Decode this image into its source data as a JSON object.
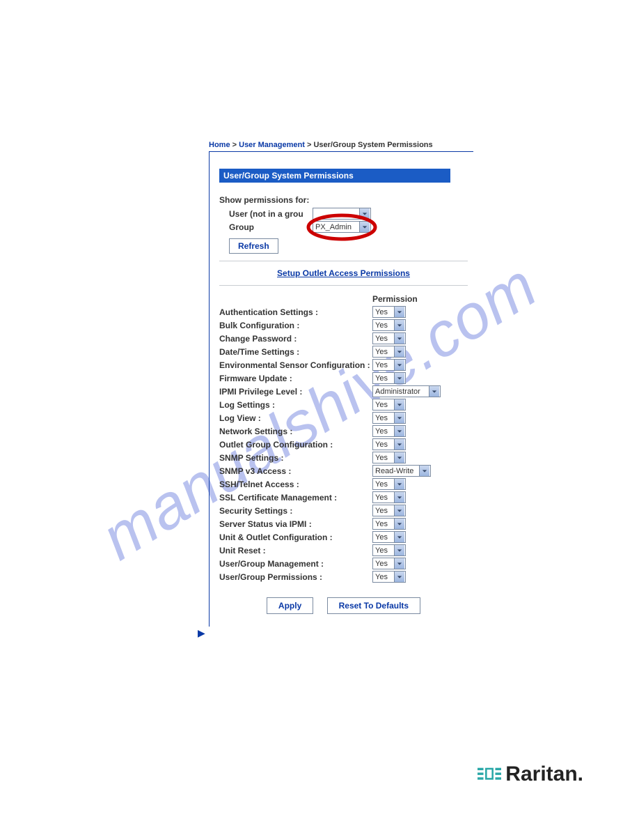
{
  "breadcrumb": {
    "home": "Home",
    "sep": ">",
    "user_mgmt": "User Management",
    "current": "User/Group System Permissions"
  },
  "panel": {
    "title": "User/Group System Permissions"
  },
  "show_perm": {
    "heading": "Show permissions for:",
    "user_label": "User (not in a grou",
    "group_label": "Group",
    "group_value": "PX_Admin",
    "refresh": "Refresh"
  },
  "outlet_link": "Setup Outlet Access Permissions",
  "col_permission": "Permission",
  "permissions": [
    {
      "label": "Authentication Settings :",
      "value": "Yes",
      "type": "yn"
    },
    {
      "label": "Bulk Configuration :",
      "value": "Yes",
      "type": "yn"
    },
    {
      "label": "Change Password :",
      "value": "Yes",
      "type": "yn"
    },
    {
      "label": "Date/Time Settings :",
      "value": "Yes",
      "type": "yn"
    },
    {
      "label": "Environmental Sensor Configuration :",
      "value": "Yes",
      "type": "yn"
    },
    {
      "label": "Firmware Update :",
      "value": "Yes",
      "type": "yn"
    },
    {
      "label": "IPMI Privilege Level :",
      "value": "Administrator",
      "type": "ipmi"
    },
    {
      "label": "Log Settings :",
      "value": "Yes",
      "type": "yn"
    },
    {
      "label": "Log View :",
      "value": "Yes",
      "type": "yn"
    },
    {
      "label": "Network Settings :",
      "value": "Yes",
      "type": "yn"
    },
    {
      "label": "Outlet Group Configuration :",
      "value": "Yes",
      "type": "yn"
    },
    {
      "label": "SNMP Settings :",
      "value": "Yes",
      "type": "yn"
    },
    {
      "label": "SNMP v3 Access :",
      "value": "Read-Write",
      "type": "snmp"
    },
    {
      "label": "SSH/Telnet Access :",
      "value": "Yes",
      "type": "yn"
    },
    {
      "label": "SSL Certificate Management :",
      "value": "Yes",
      "type": "yn"
    },
    {
      "label": "Security Settings :",
      "value": "Yes",
      "type": "yn"
    },
    {
      "label": "Server Status via IPMI :",
      "value": "Yes",
      "type": "yn"
    },
    {
      "label": "Unit & Outlet Configuration :",
      "value": "Yes",
      "type": "yn"
    },
    {
      "label": "Unit Reset :",
      "value": "Yes",
      "type": "yn"
    },
    {
      "label": "User/Group Management :",
      "value": "Yes",
      "type": "yn"
    },
    {
      "label": "User/Group Permissions :",
      "value": "Yes",
      "type": "yn"
    }
  ],
  "buttons": {
    "apply": "Apply",
    "reset": "Reset To Defaults"
  },
  "watermark": "manualshive.com",
  "brand": "Raritan."
}
